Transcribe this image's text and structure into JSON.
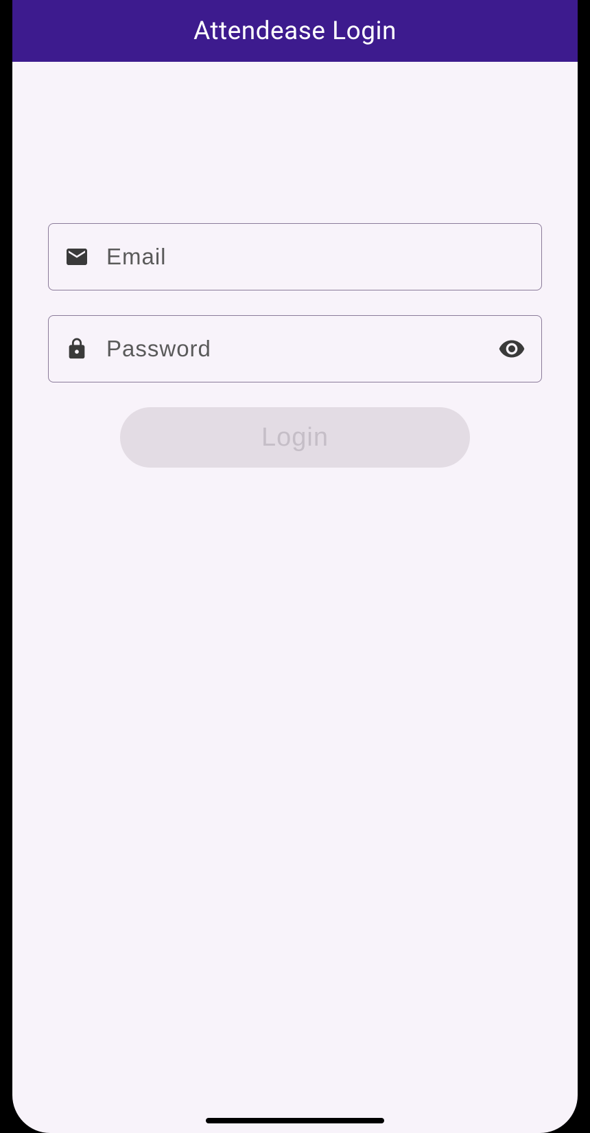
{
  "header": {
    "title": "Attendease Login"
  },
  "form": {
    "email": {
      "placeholder": "Email",
      "value": ""
    },
    "password": {
      "placeholder": "Password",
      "value": ""
    },
    "login_button_label": "Login"
  },
  "colors": {
    "brand_purple": "#3d1b8e",
    "background": "#f8f3fa",
    "border": "#8a7a99",
    "button_disabled_bg": "#e3dce4",
    "button_disabled_text": "#c5bec7"
  }
}
